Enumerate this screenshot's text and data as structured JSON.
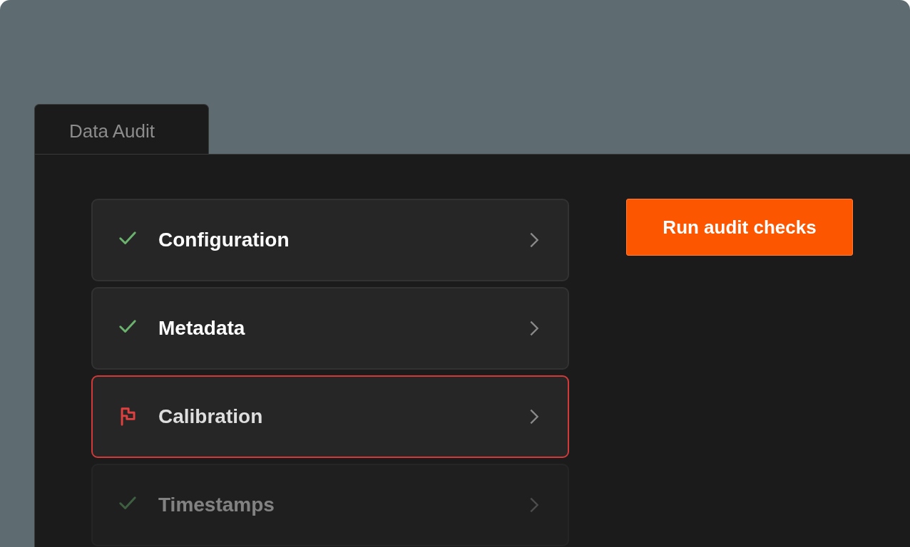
{
  "tabs": [
    {
      "label": "Data Audit",
      "selected": true
    }
  ],
  "checks": [
    {
      "label": "Configuration",
      "kind": "check",
      "flagged": false,
      "dimmed": false
    },
    {
      "label": "Metadata",
      "kind": "check",
      "flagged": false,
      "dimmed": false
    },
    {
      "label": "Calibration",
      "kind": "flag",
      "flagged": true,
      "dimmed": false
    },
    {
      "label": "Timestamps",
      "kind": "check",
      "flagged": false,
      "dimmed": true
    }
  ],
  "action_button": {
    "label": "Run audit checks"
  }
}
